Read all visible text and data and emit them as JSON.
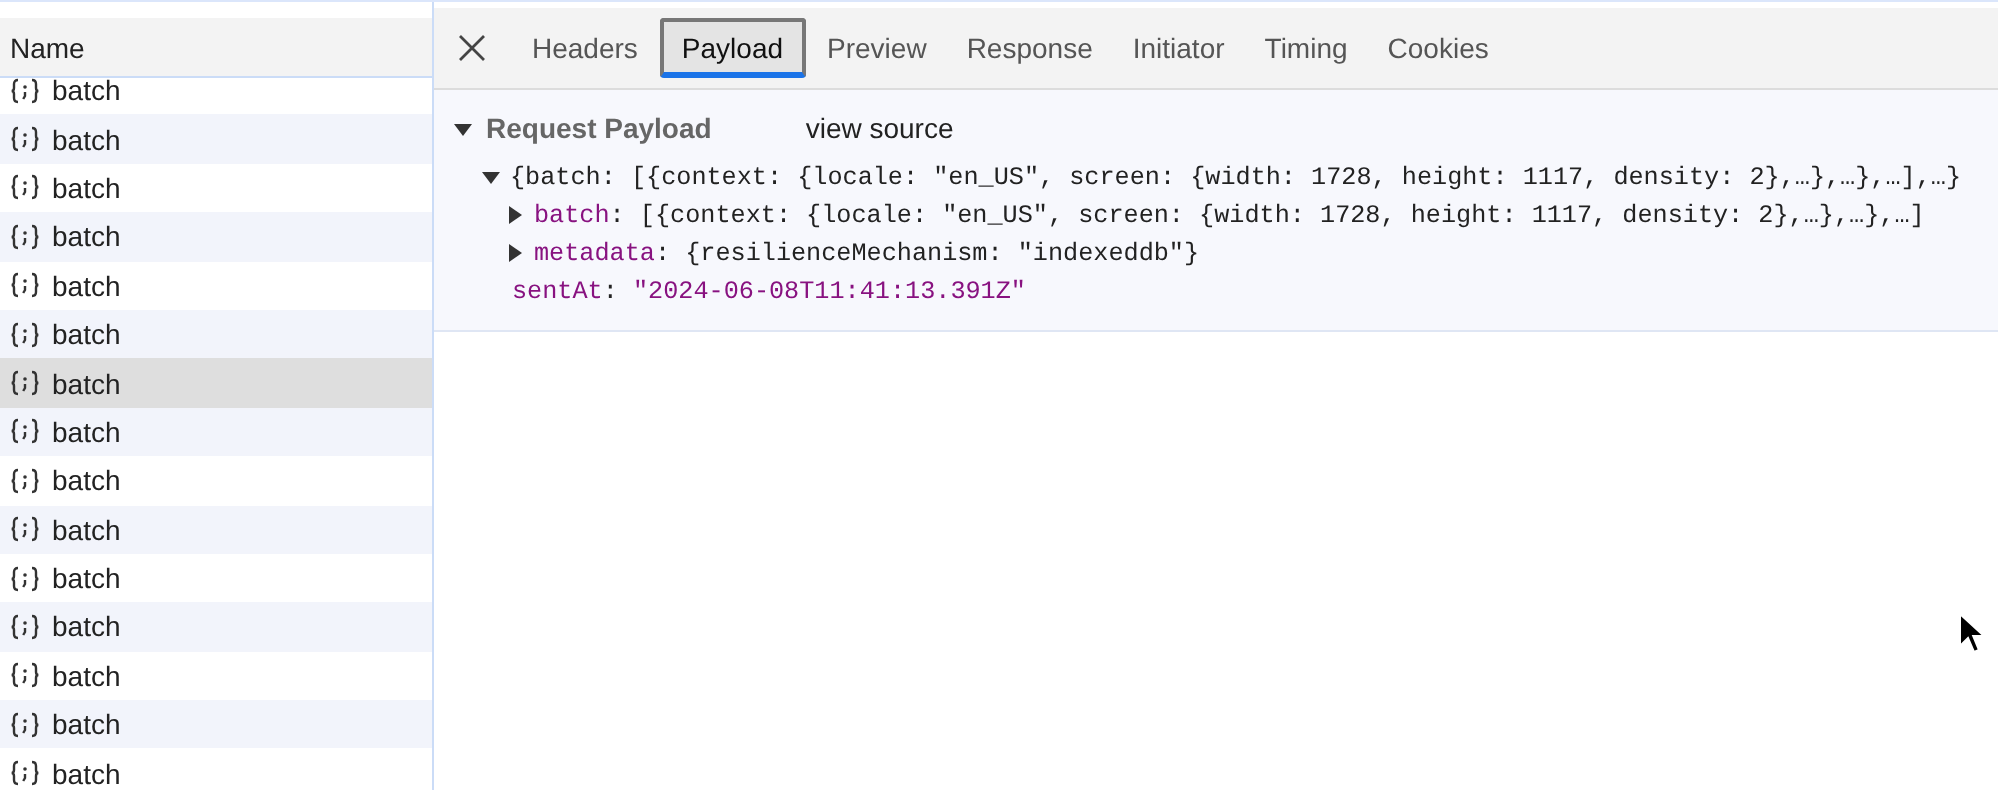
{
  "requests": {
    "column_header": "Name",
    "rows": [
      {
        "name": "batch",
        "selected": false
      },
      {
        "name": "batch",
        "selected": false
      },
      {
        "name": "batch",
        "selected": false
      },
      {
        "name": "batch",
        "selected": false
      },
      {
        "name": "batch",
        "selected": false
      },
      {
        "name": "batch",
        "selected": false
      },
      {
        "name": "batch",
        "selected": true
      },
      {
        "name": "batch",
        "selected": false
      },
      {
        "name": "batch",
        "selected": false
      },
      {
        "name": "batch",
        "selected": false
      },
      {
        "name": "batch",
        "selected": false
      },
      {
        "name": "batch",
        "selected": false
      },
      {
        "name": "batch",
        "selected": false
      },
      {
        "name": "batch",
        "selected": false
      },
      {
        "name": "batch",
        "selected": false
      }
    ]
  },
  "tabs": [
    {
      "label": "Headers",
      "selected": false
    },
    {
      "label": "Payload",
      "selected": true
    },
    {
      "label": "Preview",
      "selected": false
    },
    {
      "label": "Response",
      "selected": false
    },
    {
      "label": "Initiator",
      "selected": false
    },
    {
      "label": "Timing",
      "selected": false
    },
    {
      "label": "Cookies",
      "selected": false
    }
  ],
  "payload": {
    "title": "Request Payload",
    "expanded": true,
    "view_source": "view source",
    "separator": ":",
    "root": {
      "summary": "{batch: [{context: {locale: \"en_US\", screen: {width: 1728, height: 1117, density: 2},…},…},…],…}",
      "expanded": true,
      "children": [
        {
          "kind": "object",
          "key": "batch",
          "value": "[{context: {locale: \"en_US\", screen: {width: 1728, height: 1117, density: 2},…},…},…]",
          "expanded": false
        },
        {
          "kind": "object",
          "key": "metadata",
          "value": "{resilienceMechanism: \"indexeddb\"}",
          "expanded": false
        },
        {
          "kind": "string",
          "key": "sentAt",
          "value": "\"2024-06-08T11:41:13.391Z\""
        }
      ]
    }
  }
}
